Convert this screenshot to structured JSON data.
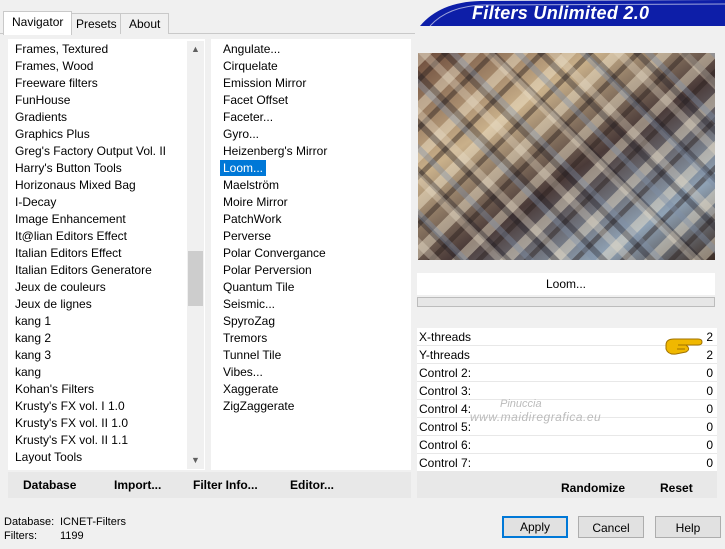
{
  "tabs": [
    {
      "label": "Navigator"
    },
    {
      "label": "Presets"
    },
    {
      "label": "About"
    }
  ],
  "brand": {
    "title": "Filters Unlimited 2.0",
    "color": "#0d1ea8"
  },
  "categories": {
    "items": [
      "Frames, Textured",
      "Frames, Wood",
      "Freeware filters",
      "FunHouse",
      "Gradients",
      "Graphics Plus",
      "Greg's Factory Output Vol. II",
      "Harry's Button Tools",
      "Horizonaus Mixed Bag",
      "I-Decay",
      "Image Enhancement",
      "It@lian Editors Effect",
      "Italian Editors Effect",
      "Italian Editors Generatore",
      "Jeux de couleurs",
      "Jeux de lignes",
      "kang 1",
      "kang 2",
      "kang 3",
      "kang",
      "Kohan's Filters",
      "Krusty's FX vol. I 1.0",
      "Krusty's FX vol. II 1.0",
      "Krusty's FX vol. II 1.1",
      "Layout Tools"
    ],
    "selected_index": 3
  },
  "filters": {
    "items": [
      "Angulate...",
      "Cirquelate",
      "Emission Mirror",
      "Facet Offset",
      "Faceter...",
      "Gyro...",
      "Heizenberg's Mirror",
      "Loom...",
      "Maelström",
      "Moire Mirror",
      "PatchWork",
      "Perverse",
      "Polar Convergance",
      "Polar Perversion",
      "Quantum Tile",
      "Seismic...",
      "SpyroZag",
      "Tremors",
      "Tunnel Tile",
      "Vibes...",
      "Xaggerate",
      "ZigZaggerate"
    ],
    "selected_index": 7
  },
  "left_buttons": {
    "database": "Database",
    "import": "Import...",
    "filter_info": "Filter Info...",
    "editor": "Editor..."
  },
  "current_filter": "Loom...",
  "controls": [
    {
      "label": "X-threads",
      "value": "2"
    },
    {
      "label": "Y-threads",
      "value": "2"
    },
    {
      "label": "Control 2:",
      "value": "0"
    },
    {
      "label": "Control 3:",
      "value": "0"
    },
    {
      "label": "Control 4:",
      "value": "0"
    },
    {
      "label": "Control 5:",
      "value": "0"
    },
    {
      "label": "Control 6:",
      "value": "0"
    },
    {
      "label": "Control 7:",
      "value": "0"
    }
  ],
  "right_buttons": {
    "randomize": "Randomize",
    "reset": "Reset"
  },
  "footer": {
    "database_label": "Database:",
    "database_value": "ICNET-Filters",
    "filters_label": "Filters:",
    "filters_value": "1199"
  },
  "dialog_buttons": {
    "apply": "Apply",
    "cancel": "Cancel",
    "help": "Help"
  },
  "watermark": {
    "line1": "Pinuccia",
    "line2": "www.maidiregrafica.eu"
  },
  "icons": {
    "pointer": "pointing-hand-icon",
    "scroll_up": "triangle-up-icon",
    "scroll_down": "triangle-down-icon"
  },
  "colors": {
    "selection": "#0078d7",
    "brand": "#0d1ea8",
    "pointer": "#f0b800"
  }
}
